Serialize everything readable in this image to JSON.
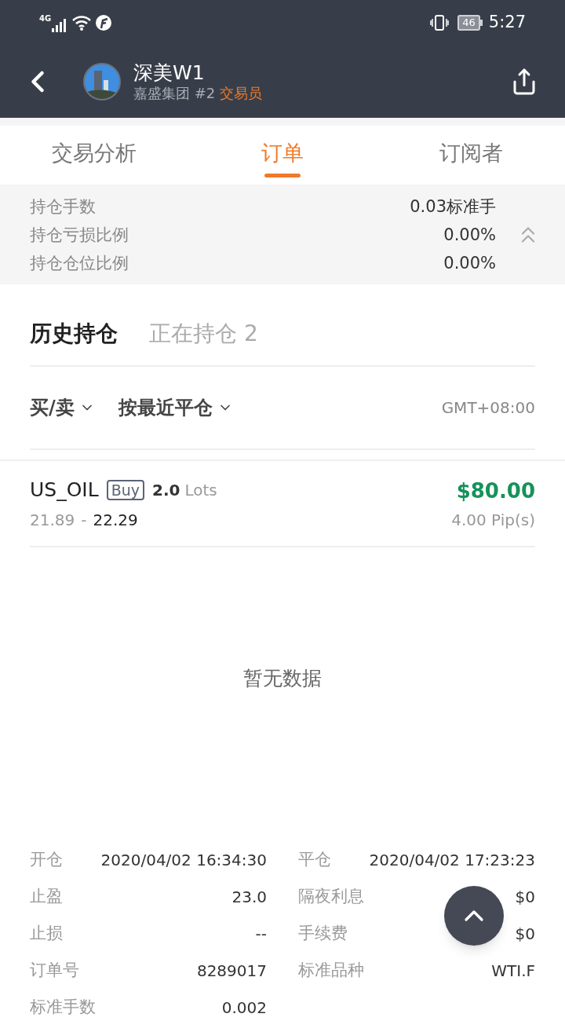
{
  "status_bar": {
    "network": "4G",
    "battery": "46",
    "time": "5:27"
  },
  "header": {
    "title": "深美W1",
    "group": "嘉盛集团",
    "rank": "#2",
    "role": "交易员"
  },
  "tabs": [
    {
      "label": "交易分析",
      "selected": false
    },
    {
      "label": "订单",
      "selected": true
    },
    {
      "label": "订阅者",
      "selected": false
    }
  ],
  "summary": [
    {
      "label": "持仓手数",
      "value": "0.03标准手"
    },
    {
      "label": "持仓亏损比例",
      "value": "0.00%"
    },
    {
      "label": "持仓仓位比例",
      "value": "0.00%"
    }
  ],
  "summary_expanded": true,
  "subtabs": [
    {
      "label": "历史持仓",
      "selected": true
    },
    {
      "label": "正在持仓 2",
      "selected": false
    }
  ],
  "filters": [
    {
      "label": "买/卖"
    },
    {
      "label": "按最近平仓"
    }
  ],
  "timezone": "GMT+08:00",
  "order": {
    "symbol": "US_OIL",
    "side": "Buy",
    "lots": "2.0",
    "lots_unit": "Lots",
    "open_price": "21.89",
    "separator": "-",
    "close_price": "22.29",
    "profit": "$80.00",
    "pips": "4.00 Pip(s)"
  },
  "empty_text": "暂无数据",
  "details": [
    [
      {
        "label": "开仓",
        "value": "2020/04/02 16:34:30"
      },
      {
        "label": "平仓",
        "value": "2020/04/02 17:23:23"
      }
    ],
    [
      {
        "label": "止盈",
        "value": "23.0"
      },
      {
        "label": "隔夜利息",
        "value": "$0"
      }
    ],
    [
      {
        "label": "止损",
        "value": "--"
      },
      {
        "label": "手续费",
        "value": "$0"
      }
    ],
    [
      {
        "label": "订单号",
        "value": "8289017"
      },
      {
        "label": "标准品种",
        "value": "WTI.F"
      }
    ],
    [
      {
        "label": "标准手数",
        "value": "0.002"
      }
    ]
  ]
}
